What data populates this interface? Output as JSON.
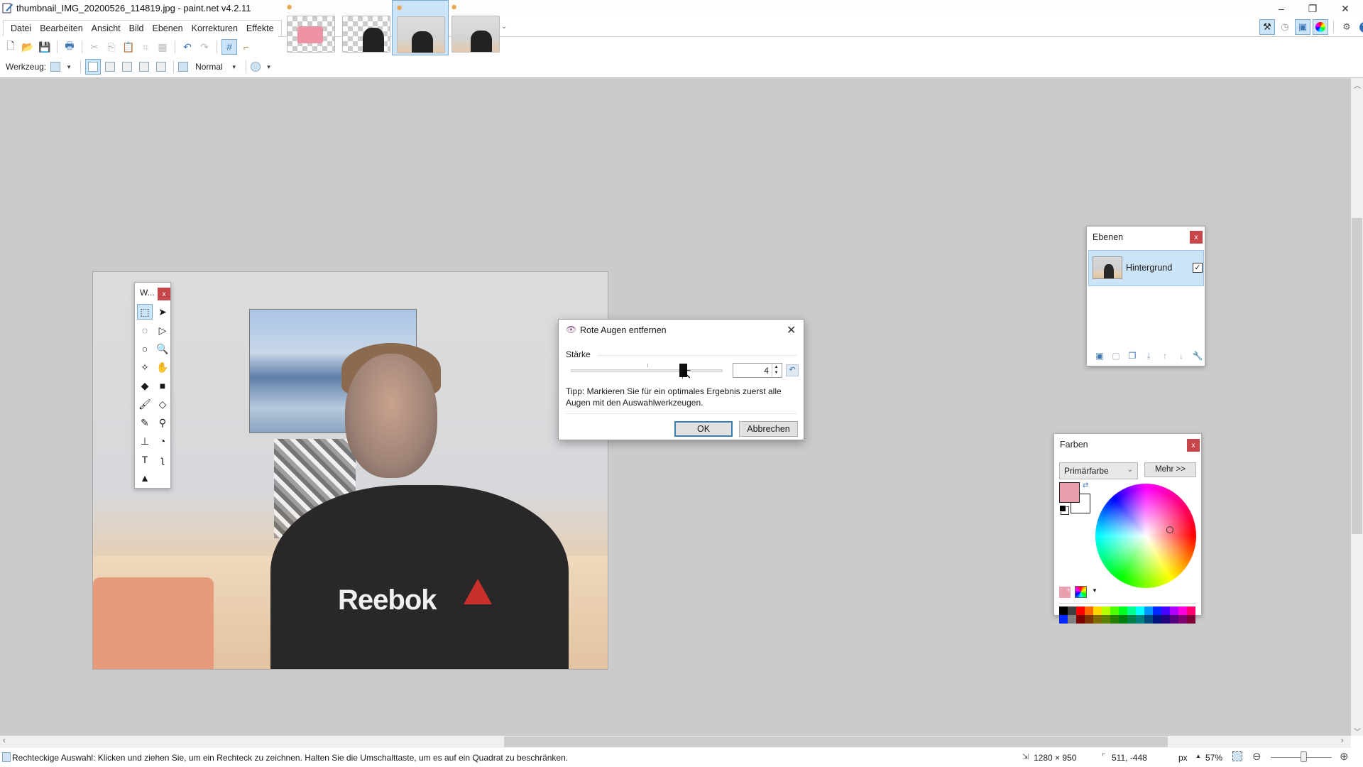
{
  "window": {
    "title": "thumbnail_IMG_20200526_114819.jpg - paint.net v4.2.11",
    "minimize": "–",
    "maximize": "❐",
    "close": "✕"
  },
  "menu": [
    "Datei",
    "Bearbeiten",
    "Ansicht",
    "Bild",
    "Ebenen",
    "Korrekturen",
    "Effekte"
  ],
  "image_tabs": [
    {
      "name": "pink-rectangle-image",
      "dirty": true,
      "active": false
    },
    {
      "name": "person-cutout-image",
      "dirty": false,
      "active": false
    },
    {
      "name": "thumbnail-image",
      "dirty": true,
      "active": true
    },
    {
      "name": "photo-copy-image",
      "dirty": true,
      "active": false
    }
  ],
  "toolbar": {
    "tool_label": "Werkzeug:",
    "blend_mode": "Normal"
  },
  "right_toolbar": [
    "tools-window-toggle",
    "history-window-toggle",
    "layers-window-toggle",
    "colors-window-toggle",
    "settings",
    "help"
  ],
  "tools_window": {
    "title": "W...",
    "close": "x",
    "tools": [
      {
        "name": "rectangle-select",
        "glyph": "⬚",
        "active": true
      },
      {
        "name": "move-selected-pixels",
        "glyph": "➤",
        "active": false
      },
      {
        "name": "lasso-select",
        "glyph": "◌",
        "active": false
      },
      {
        "name": "move-selection",
        "glyph": "▷",
        "active": false
      },
      {
        "name": "ellipse-select",
        "glyph": "○",
        "active": false
      },
      {
        "name": "zoom",
        "glyph": "🔍",
        "active": false
      },
      {
        "name": "magic-wand",
        "glyph": "✧",
        "active": false
      },
      {
        "name": "pan",
        "glyph": "✋",
        "active": false
      },
      {
        "name": "paint-bucket",
        "glyph": "◆",
        "active": false
      },
      {
        "name": "gradient",
        "glyph": "■",
        "active": false
      },
      {
        "name": "paintbrush",
        "glyph": "🖌",
        "active": false
      },
      {
        "name": "eraser",
        "glyph": "◇",
        "active": false
      },
      {
        "name": "pencil",
        "glyph": "✎",
        "active": false
      },
      {
        "name": "color-picker",
        "glyph": "⚲",
        "active": false
      },
      {
        "name": "clone-stamp",
        "glyph": "⊥",
        "active": false
      },
      {
        "name": "recolor",
        "glyph": "◔",
        "active": false
      },
      {
        "name": "text",
        "glyph": "T",
        "active": false
      },
      {
        "name": "line-curve",
        "glyph": "ʅ",
        "active": false
      },
      {
        "name": "shapes",
        "glyph": "▲",
        "active": false
      }
    ]
  },
  "layers_window": {
    "title": "Ebenen",
    "close": "x",
    "layers": [
      {
        "name": "Hintergrund",
        "visible": true,
        "selected": true
      }
    ],
    "check_glyph": "✓"
  },
  "colors_window": {
    "title": "Farben",
    "close": "x",
    "mode": "Primärfarbe",
    "more_button": "Mehr >>",
    "primary_color": "#e8a0b0",
    "secondary_color": "#ffffff",
    "palette": [
      "#000000",
      "#404040",
      "#ff0000",
      "#ff6a00",
      "#ffd800",
      "#b6ff00",
      "#4cff00",
      "#00ff21",
      "#00ff90",
      "#00ffff",
      "#0094ff",
      "#0026ff",
      "#4800ff",
      "#b200ff",
      "#ff00dc",
      "#ff006e",
      "#0026ff",
      "#808080",
      "#7f0000",
      "#7f3300",
      "#7f6a00",
      "#5b7f00",
      "#267f00",
      "#007f0e",
      "#007f46",
      "#007f7f",
      "#004a7f",
      "#00137f",
      "#21007f",
      "#57007f",
      "#7f006e",
      "#7f0037"
    ]
  },
  "dialog": {
    "title": "Rote Augen entfernen",
    "close": "✕",
    "group_label": "Stärke",
    "slider_fraction": 0.74,
    "value": "4",
    "tip": "Tipp: Markieren Sie für ein optimales Ergebnis zuerst alle Augen mit den Auswahlwerkzeugen.",
    "ok": "OK",
    "cancel": "Abbrechen"
  },
  "canvas": {
    "shirt_text": "Reebok"
  },
  "status": {
    "hint": "Rechteckige Auswahl: Klicken und ziehen Sie, um ein Rechteck zu zeichnen. Halten Sie die Umschalttaste, um es auf ein Quadrat zu beschränken.",
    "image_size": "1280 × 950",
    "cursor_position": "511, -448",
    "unit": "px",
    "zoom": "57%",
    "zoom_slider_fraction": 0.53
  }
}
